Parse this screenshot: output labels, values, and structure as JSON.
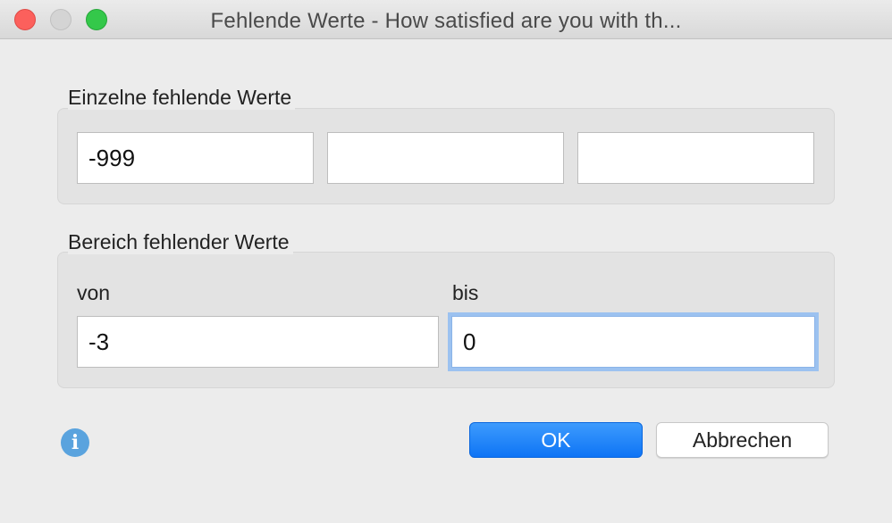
{
  "window": {
    "title": "Fehlende Werte - How satisfied are you with th..."
  },
  "single_missing": {
    "label": "Einzelne fehlende Werte",
    "values": [
      "-999",
      "",
      ""
    ]
  },
  "range_missing": {
    "label": "Bereich fehlender Werte",
    "from_label": "von",
    "to_label": "bis",
    "from_value": "-3",
    "to_value": "0"
  },
  "buttons": {
    "ok": "OK",
    "cancel": "Abbrechen"
  },
  "colors": {
    "accent": "#1a7ef7",
    "info": "#5aa3de",
    "close": "#fc605c",
    "maximize": "#34c84a"
  },
  "icons": {
    "info": "info-icon"
  }
}
